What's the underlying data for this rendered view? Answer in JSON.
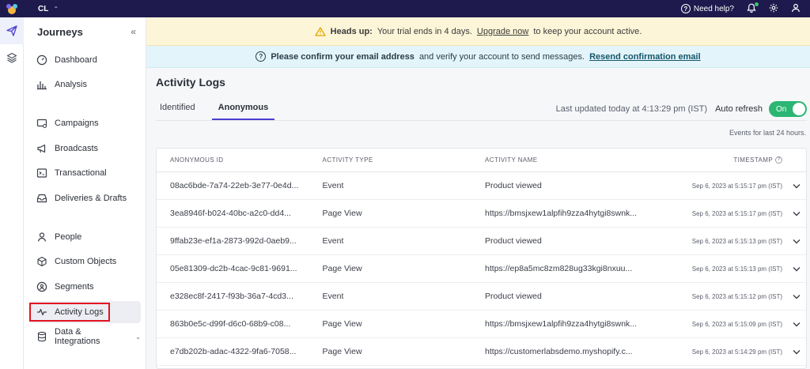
{
  "topbar": {
    "workspace": "CL",
    "help_label": "Need help?"
  },
  "sidebar": {
    "title": "Journeys",
    "items": [
      {
        "label": "Dashboard",
        "icon": "dashboard-gauge-icon"
      },
      {
        "label": "Analysis",
        "icon": "bar-chart-icon"
      },
      {
        "label": "Campaigns",
        "icon": "campaigns-icon"
      },
      {
        "label": "Broadcasts",
        "icon": "megaphone-icon"
      },
      {
        "label": "Transactional",
        "icon": "terminal-icon"
      },
      {
        "label": "Deliveries & Drafts",
        "icon": "inbox-icon"
      },
      {
        "label": "People",
        "icon": "person-icon"
      },
      {
        "label": "Custom Objects",
        "icon": "cube-icon"
      },
      {
        "label": "Segments",
        "icon": "segments-icon"
      },
      {
        "label": "Activity Logs",
        "icon": "activity-pulse-icon"
      },
      {
        "label": "Data & Integrations",
        "icon": "database-icon"
      }
    ]
  },
  "banners": {
    "warning_strong": "Heads up:",
    "warning_text": "Your trial ends in 4 days.",
    "warning_link": "Upgrade now",
    "warning_tail": "to keep your account active.",
    "info_strong": "Please confirm your email address",
    "info_text": "and verify your account to send messages.",
    "info_link": "Resend confirmation email"
  },
  "page": {
    "title": "Activity Logs",
    "tabs": [
      "Identified",
      "Anonymous"
    ],
    "active_tab": "Anonymous",
    "last_updated": "Last updated today at 4:13:29 pm (IST)",
    "auto_refresh_label": "Auto refresh",
    "toggle_label": "On",
    "events_note": "Events for last 24 hours."
  },
  "table": {
    "headers": [
      "ANONYMOUS ID",
      "ACTIVITY TYPE",
      "ACTIVITY NAME",
      "TIMESTAMP"
    ],
    "rows": [
      {
        "id": "08ac6bde-7a74-22eb-3e77-0e4d...",
        "type": "Event",
        "name": "Product viewed",
        "timestamp": "Sep 6, 2023 at 5:15:17 pm (IST)"
      },
      {
        "id": "3ea8946f-b024-40bc-a2c0-dd4...",
        "type": "Page View",
        "name": "https://bmsjxew1alpfih9zza4hytgi8swnk...",
        "timestamp": "Sep 6, 2023 at 5:15:17 pm (IST)"
      },
      {
        "id": "9ffab23e-ef1a-2873-992d-0aeb9...",
        "type": "Event",
        "name": "Product viewed",
        "timestamp": "Sep 6, 2023 at 5:15:13 pm (IST)"
      },
      {
        "id": "05e81309-dc2b-4cac-9c81-9691...",
        "type": "Page View",
        "name": "https://ep8a5mc8zm828ug33kgi8nxuu...",
        "timestamp": "Sep 6, 2023 at 5:15:13 pm (IST)"
      },
      {
        "id": "e328ec8f-2417-f93b-36a7-4cd3...",
        "type": "Event",
        "name": "Product viewed",
        "timestamp": "Sep 6, 2023 at 5:15:12 pm (IST)"
      },
      {
        "id": "863b0e5c-d99f-d6c0-68b9-c08...",
        "type": "Page View",
        "name": "https://bmsjxew1alpfih9zza4hytgi8swnk...",
        "timestamp": "Sep 6, 2023 at 5:15:09 pm (IST)"
      },
      {
        "id": "e7db202b-adac-4322-9fa6-7058...",
        "type": "Page View",
        "name": "https://customerlabsdemo.myshopify.c...",
        "timestamp": "Sep 6, 2023 at 5:14:29 pm (IST)"
      }
    ]
  },
  "colors": {
    "topbar": "#1f1a4d",
    "accent": "#4b3fd1",
    "toggle_on": "#2bb673",
    "highlight": "#e2141f"
  }
}
